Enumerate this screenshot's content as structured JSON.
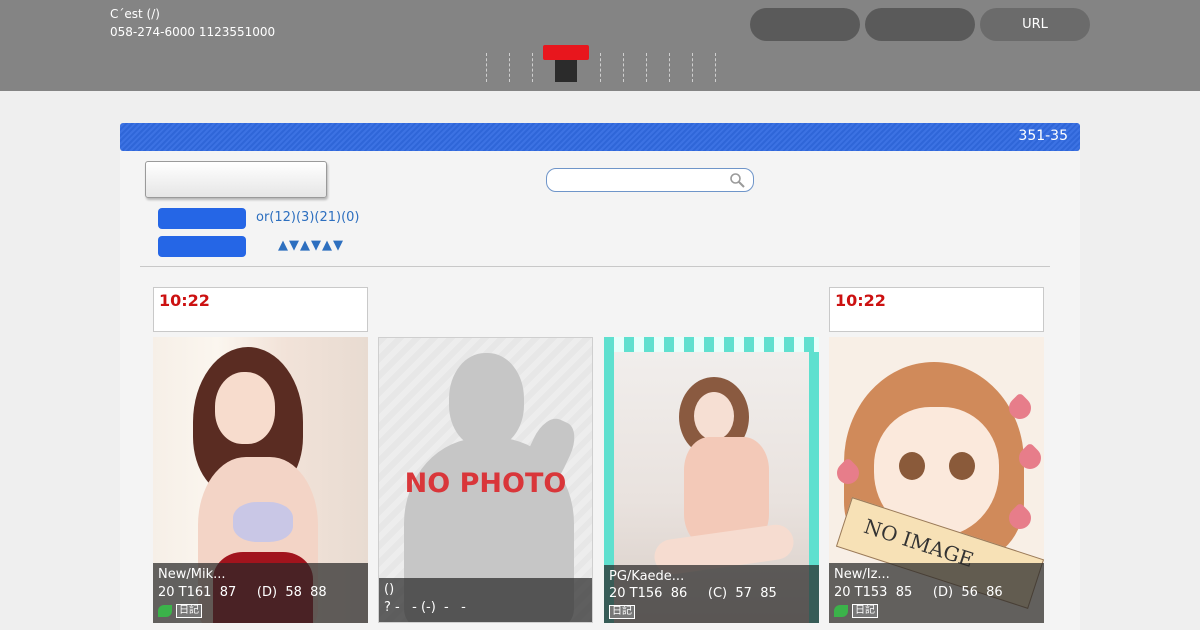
{
  "header": {
    "shop_name": "C´est (/)",
    "tel": "058-274-6000 1123551000",
    "buttons": [
      "",
      "",
      "URL"
    ]
  },
  "panel": {
    "bar_text": "351-35",
    "search_placeholder": "",
    "filter_text": "or(12)(3)(21)(0)",
    "sort_arrows": "▲▼▲▼▲▼"
  },
  "cards": [
    {
      "time": "10:22",
      "name": "New/Mik...",
      "stats": "20 T161  87     (D)  58  88",
      "diary_label": "日記",
      "photo_label": ""
    },
    {
      "time": "",
      "name": "()",
      "stats": "? -   - (-)  -   -",
      "diary_label": "",
      "photo_label": "NO PHOTO"
    },
    {
      "time": "",
      "name": "PG/Kaede...",
      "stats": "20 T156  86     (C)  57  85",
      "diary_label": "日記",
      "photo_label": ""
    },
    {
      "time": "10:22",
      "name": "New/Iz...",
      "stats": "20 T153  85     (D)  56  86",
      "diary_label": "日記",
      "photo_label": "NO IMAGE"
    }
  ],
  "colors": {
    "accent_blue": "#2566e6",
    "time_red": "#cc1111",
    "header_gray": "#848484"
  }
}
